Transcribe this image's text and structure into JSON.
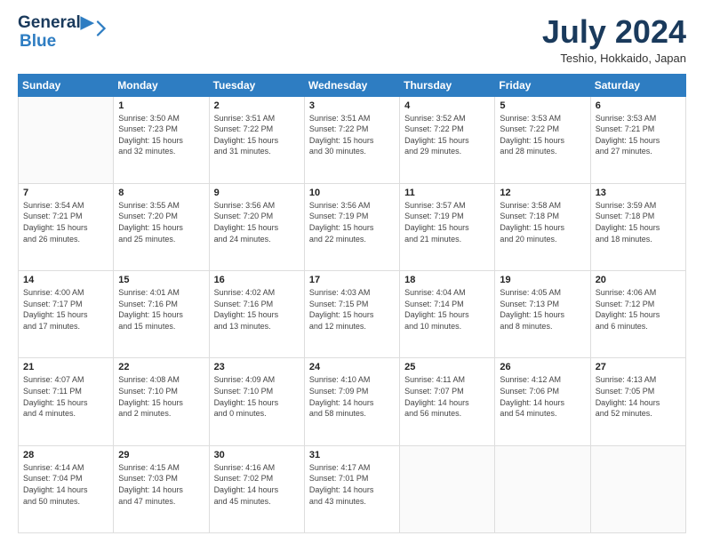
{
  "header": {
    "logo_line1": "General",
    "logo_line2": "Blue",
    "month": "July 2024",
    "location": "Teshio, Hokkaido, Japan"
  },
  "weekdays": [
    "Sunday",
    "Monday",
    "Tuesday",
    "Wednesday",
    "Thursday",
    "Friday",
    "Saturday"
  ],
  "weeks": [
    [
      {
        "day": "",
        "content": ""
      },
      {
        "day": "1",
        "content": "Sunrise: 3:50 AM\nSunset: 7:23 PM\nDaylight: 15 hours\nand 32 minutes."
      },
      {
        "day": "2",
        "content": "Sunrise: 3:51 AM\nSunset: 7:22 PM\nDaylight: 15 hours\nand 31 minutes."
      },
      {
        "day": "3",
        "content": "Sunrise: 3:51 AM\nSunset: 7:22 PM\nDaylight: 15 hours\nand 30 minutes."
      },
      {
        "day": "4",
        "content": "Sunrise: 3:52 AM\nSunset: 7:22 PM\nDaylight: 15 hours\nand 29 minutes."
      },
      {
        "day": "5",
        "content": "Sunrise: 3:53 AM\nSunset: 7:22 PM\nDaylight: 15 hours\nand 28 minutes."
      },
      {
        "day": "6",
        "content": "Sunrise: 3:53 AM\nSunset: 7:21 PM\nDaylight: 15 hours\nand 27 minutes."
      }
    ],
    [
      {
        "day": "7",
        "content": "Sunrise: 3:54 AM\nSunset: 7:21 PM\nDaylight: 15 hours\nand 26 minutes."
      },
      {
        "day": "8",
        "content": "Sunrise: 3:55 AM\nSunset: 7:20 PM\nDaylight: 15 hours\nand 25 minutes."
      },
      {
        "day": "9",
        "content": "Sunrise: 3:56 AM\nSunset: 7:20 PM\nDaylight: 15 hours\nand 24 minutes."
      },
      {
        "day": "10",
        "content": "Sunrise: 3:56 AM\nSunset: 7:19 PM\nDaylight: 15 hours\nand 22 minutes."
      },
      {
        "day": "11",
        "content": "Sunrise: 3:57 AM\nSunset: 7:19 PM\nDaylight: 15 hours\nand 21 minutes."
      },
      {
        "day": "12",
        "content": "Sunrise: 3:58 AM\nSunset: 7:18 PM\nDaylight: 15 hours\nand 20 minutes."
      },
      {
        "day": "13",
        "content": "Sunrise: 3:59 AM\nSunset: 7:18 PM\nDaylight: 15 hours\nand 18 minutes."
      }
    ],
    [
      {
        "day": "14",
        "content": "Sunrise: 4:00 AM\nSunset: 7:17 PM\nDaylight: 15 hours\nand 17 minutes."
      },
      {
        "day": "15",
        "content": "Sunrise: 4:01 AM\nSunset: 7:16 PM\nDaylight: 15 hours\nand 15 minutes."
      },
      {
        "day": "16",
        "content": "Sunrise: 4:02 AM\nSunset: 7:16 PM\nDaylight: 15 hours\nand 13 minutes."
      },
      {
        "day": "17",
        "content": "Sunrise: 4:03 AM\nSunset: 7:15 PM\nDaylight: 15 hours\nand 12 minutes."
      },
      {
        "day": "18",
        "content": "Sunrise: 4:04 AM\nSunset: 7:14 PM\nDaylight: 15 hours\nand 10 minutes."
      },
      {
        "day": "19",
        "content": "Sunrise: 4:05 AM\nSunset: 7:13 PM\nDaylight: 15 hours\nand 8 minutes."
      },
      {
        "day": "20",
        "content": "Sunrise: 4:06 AM\nSunset: 7:12 PM\nDaylight: 15 hours\nand 6 minutes."
      }
    ],
    [
      {
        "day": "21",
        "content": "Sunrise: 4:07 AM\nSunset: 7:11 PM\nDaylight: 15 hours\nand 4 minutes."
      },
      {
        "day": "22",
        "content": "Sunrise: 4:08 AM\nSunset: 7:10 PM\nDaylight: 15 hours\nand 2 minutes."
      },
      {
        "day": "23",
        "content": "Sunrise: 4:09 AM\nSunset: 7:10 PM\nDaylight: 15 hours\nand 0 minutes."
      },
      {
        "day": "24",
        "content": "Sunrise: 4:10 AM\nSunset: 7:09 PM\nDaylight: 14 hours\nand 58 minutes."
      },
      {
        "day": "25",
        "content": "Sunrise: 4:11 AM\nSunset: 7:07 PM\nDaylight: 14 hours\nand 56 minutes."
      },
      {
        "day": "26",
        "content": "Sunrise: 4:12 AM\nSunset: 7:06 PM\nDaylight: 14 hours\nand 54 minutes."
      },
      {
        "day": "27",
        "content": "Sunrise: 4:13 AM\nSunset: 7:05 PM\nDaylight: 14 hours\nand 52 minutes."
      }
    ],
    [
      {
        "day": "28",
        "content": "Sunrise: 4:14 AM\nSunset: 7:04 PM\nDaylight: 14 hours\nand 50 minutes."
      },
      {
        "day": "29",
        "content": "Sunrise: 4:15 AM\nSunset: 7:03 PM\nDaylight: 14 hours\nand 47 minutes."
      },
      {
        "day": "30",
        "content": "Sunrise: 4:16 AM\nSunset: 7:02 PM\nDaylight: 14 hours\nand 45 minutes."
      },
      {
        "day": "31",
        "content": "Sunrise: 4:17 AM\nSunset: 7:01 PM\nDaylight: 14 hours\nand 43 minutes."
      },
      {
        "day": "",
        "content": ""
      },
      {
        "day": "",
        "content": ""
      },
      {
        "day": "",
        "content": ""
      }
    ]
  ]
}
